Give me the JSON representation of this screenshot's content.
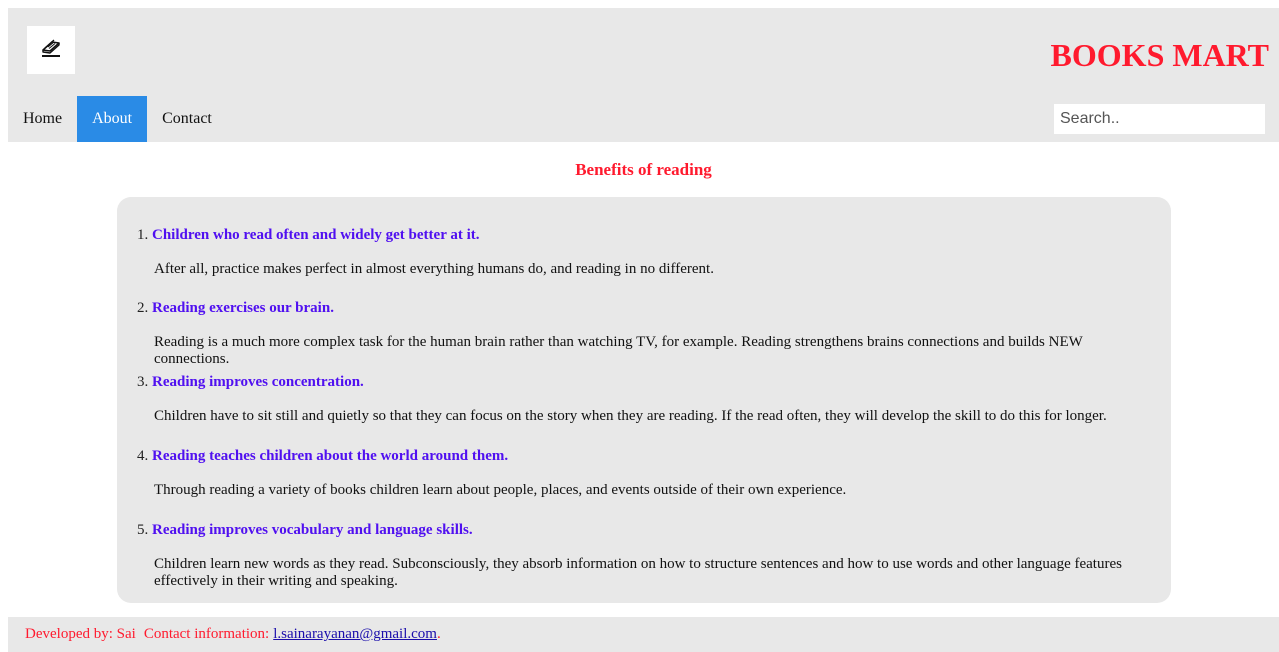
{
  "header": {
    "logo_icon": "open-book-icon",
    "brand": "BOOKS MART",
    "brand_color": "#ff1a2e"
  },
  "nav": {
    "items": [
      {
        "label": "Home",
        "active": false
      },
      {
        "label": "About",
        "active": true
      },
      {
        "label": "Contact",
        "active": false
      }
    ],
    "active_color": "#2a8be6"
  },
  "search": {
    "placeholder": "Search..",
    "value": ""
  },
  "main": {
    "title": "Benefits of reading",
    "benefits": [
      {
        "number": "1.",
        "title": "Children who read often and widely get better at it.",
        "text": "After all, practice makes perfect in almost everything humans do, and reading in no different."
      },
      {
        "number": "2.",
        "title": "Reading exercises our brain.",
        "text": "Reading is a much more complex task for the human brain rather than watching TV, for example. Reading strengthens brains connections and builds NEW connections."
      },
      {
        "number": "3.",
        "title": "Reading improves concentration.",
        "text": "Children have to sit still and quietly so that they can focus on the story when they are reading. If the read often, they will develop the skill to do this for longer."
      },
      {
        "number": "4.",
        "title": "Reading teaches children about the world around them.",
        "text": "Through reading a variety of books children learn about people, places, and events outside of their own experience."
      },
      {
        "number": "5.",
        "title": "Reading improves vocabulary and language skills.",
        "text": "Children learn new words as they read. Subconsciously, they absorb information on how to structure sentences and how to use words and other language features effectively in their writing and speaking."
      }
    ],
    "heading_color": "#5010f0"
  },
  "footer": {
    "developer": "Developed by: Sai",
    "contact_label": "Contact information:",
    "email": "l.sainarayanan@gmail.com",
    "trailing": "."
  }
}
